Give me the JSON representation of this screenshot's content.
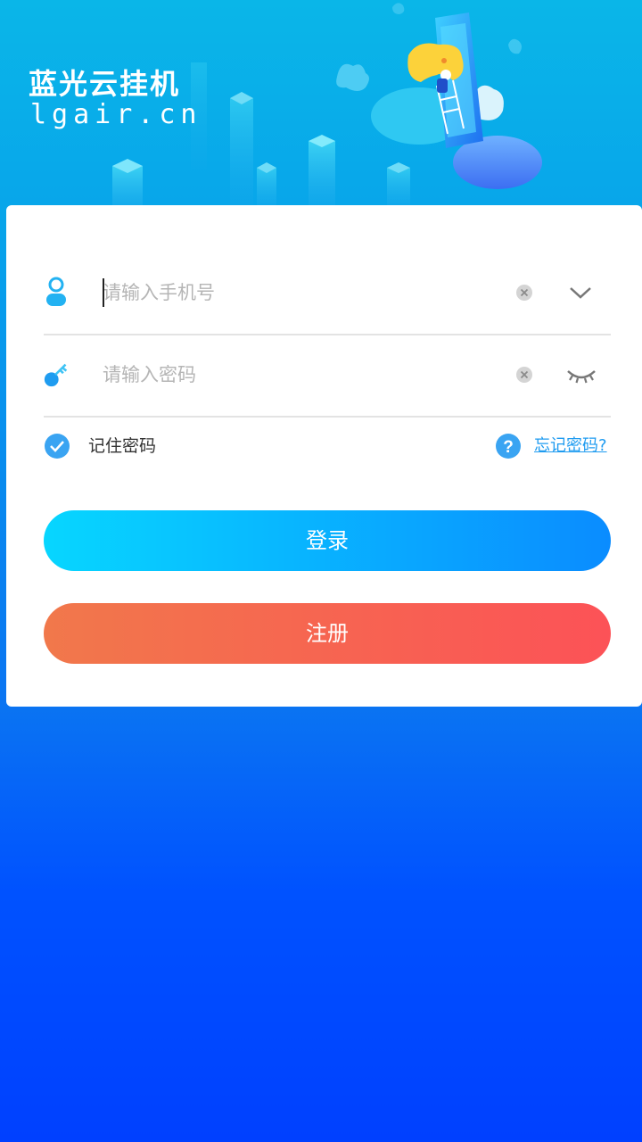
{
  "brand": {
    "name": "蓝光云挂机",
    "domain": "lgair.cn"
  },
  "login_form": {
    "phone": {
      "placeholder": "请输入手机号",
      "value": ""
    },
    "password": {
      "placeholder": "请输入密码",
      "value": ""
    },
    "remember": {
      "label": "记住密码",
      "checked": true
    },
    "forgot_label": "忘记密码?",
    "login_label": "登录",
    "register_label": "注册"
  },
  "icons": {
    "phone_field": "user-icon",
    "password_field": "key-icon",
    "clear": "clear-icon",
    "dropdown": "chevron-down-icon",
    "password_visibility": "eye-closed-icon",
    "remember_checkbox": "check-icon",
    "help": "question-icon"
  },
  "colors": {
    "accent": "#1e9bf0",
    "login_gradient_start": "#07d6ff",
    "login_gradient_end": "#0a8cff",
    "register_gradient_start": "#f1784b",
    "register_gradient_end": "#fc5257",
    "background_bottom": "#0040ff"
  }
}
